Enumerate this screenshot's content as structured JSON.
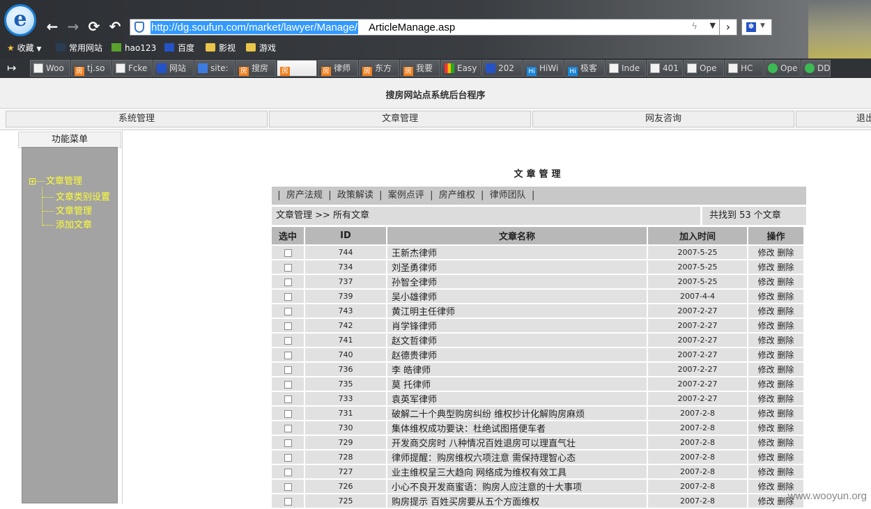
{
  "browser": {
    "url_selected": "http://dg.soufun.com/market/lawyer/Manage/",
    "url_rest": "ArticleManage.asp",
    "favorites": [
      {
        "label": "收藏",
        "icon": "star-icon"
      },
      {
        "label": "常用网站",
        "icon": "sites-icon"
      },
      {
        "label": "hao123",
        "icon": "hao123-icon"
      },
      {
        "label": "百度",
        "icon": "baidu-paw-icon"
      },
      {
        "label": "影视",
        "icon": "folder-icon"
      },
      {
        "label": "游戏",
        "icon": "folder-icon"
      }
    ],
    "tabs": [
      {
        "label": "Woo",
        "icon": "doc-icon"
      },
      {
        "label": "tj.so",
        "icon": "fang-icon"
      },
      {
        "label": "Fcke",
        "icon": "doc-icon"
      },
      {
        "label": "网站",
        "icon": "baidu-paw-icon"
      },
      {
        "label": "site:",
        "icon": "google-icon"
      },
      {
        "label": "搜房",
        "icon": "fang-icon"
      },
      {
        "label": "",
        "icon": "fang-icon"
      },
      {
        "label": "律师",
        "icon": "fang-icon"
      },
      {
        "label": "东方",
        "icon": "fang-icon"
      },
      {
        "label": "我要",
        "icon": "fang-icon"
      },
      {
        "label": "Easy",
        "icon": "google-icon"
      },
      {
        "label": "202",
        "icon": "baidu-paw-icon"
      },
      {
        "label": "HiWi",
        "icon": "hi-icon"
      },
      {
        "label": "极客",
        "icon": "hi-icon"
      },
      {
        "label": "Inde",
        "icon": "doc-icon"
      },
      {
        "label": "401",
        "icon": "doc-icon"
      },
      {
        "label": "Ope",
        "icon": "doc-icon"
      },
      {
        "label": "HC",
        "icon": "doc-icon"
      },
      {
        "label": "Ope",
        "icon": "chrome-icon"
      },
      {
        "label": "DD",
        "icon": "chrome-icon"
      }
    ]
  },
  "page": {
    "site_title": "搜房网站点系统后台程序",
    "nav": [
      "系统管理",
      "文章管理",
      "网友咨询",
      "退出"
    ],
    "menu": {
      "title": "功能菜单",
      "root": "文章管理",
      "children": [
        "文章类别设置",
        "文章管理",
        "添加文章"
      ]
    },
    "content_title": "文章管理",
    "categories": [
      "房产法规",
      "政策解读",
      "案例点评",
      "房产维权",
      "律师团队"
    ],
    "breadcrumb": "文章管理 >> 所有文章",
    "found": "共找到 53 个文章",
    "columns": [
      "选中",
      "ID",
      "文章名称",
      "加入时间",
      "操作"
    ],
    "op_edit": "修改",
    "op_delete": "删除",
    "rows": [
      {
        "id": "744",
        "name": "王新杰律师",
        "date": "2007-5-25"
      },
      {
        "id": "734",
        "name": "刘圣勇律师",
        "date": "2007-5-25"
      },
      {
        "id": "737",
        "name": "孙智全律师",
        "date": "2007-5-25"
      },
      {
        "id": "739",
        "name": "吴小雄律师",
        "date": "2007-4-4"
      },
      {
        "id": "743",
        "name": "黄江明主任律师",
        "date": "2007-2-27"
      },
      {
        "id": "742",
        "name": "肖学锋律师",
        "date": "2007-2-27"
      },
      {
        "id": "741",
        "name": "赵文哲律师",
        "date": "2007-2-27"
      },
      {
        "id": "740",
        "name": "赵德贵律师",
        "date": "2007-2-27"
      },
      {
        "id": "736",
        "name": "李 皓律师",
        "date": "2007-2-27"
      },
      {
        "id": "735",
        "name": "莫 托律师",
        "date": "2007-2-27"
      },
      {
        "id": "733",
        "name": "袁英军律师",
        "date": "2007-2-27"
      },
      {
        "id": "731",
        "name": "破解二十个典型购房纠纷 维权抄计化解购房麻烦",
        "date": "2007-2-8"
      },
      {
        "id": "730",
        "name": "集体维权成功要诀：杜绝试图搭便车者",
        "date": "2007-2-8"
      },
      {
        "id": "729",
        "name": "开发商交房时 八种情况百姓退房可以理直气壮",
        "date": "2007-2-8"
      },
      {
        "id": "728",
        "name": "律师提醒：购房维权六项注意 需保持理智心态",
        "date": "2007-2-8"
      },
      {
        "id": "727",
        "name": "业主维权呈三大趋向 网络成为维权有效工具",
        "date": "2007-2-8"
      },
      {
        "id": "726",
        "name": "小心不良开发商蜜语：购房人应注意的十大事项",
        "date": "2007-2-8"
      },
      {
        "id": "725",
        "name": "购房提示 百姓买房要从五个方面维权",
        "date": "2007-2-8"
      }
    ]
  },
  "watermark": "www.wooyun.org",
  "colors": {
    "tree_text": "#ffff33",
    "menu_bg": "#a3a3a3",
    "row_bg": "#e1e1e1",
    "header_bg": "#b8b8b8"
  }
}
